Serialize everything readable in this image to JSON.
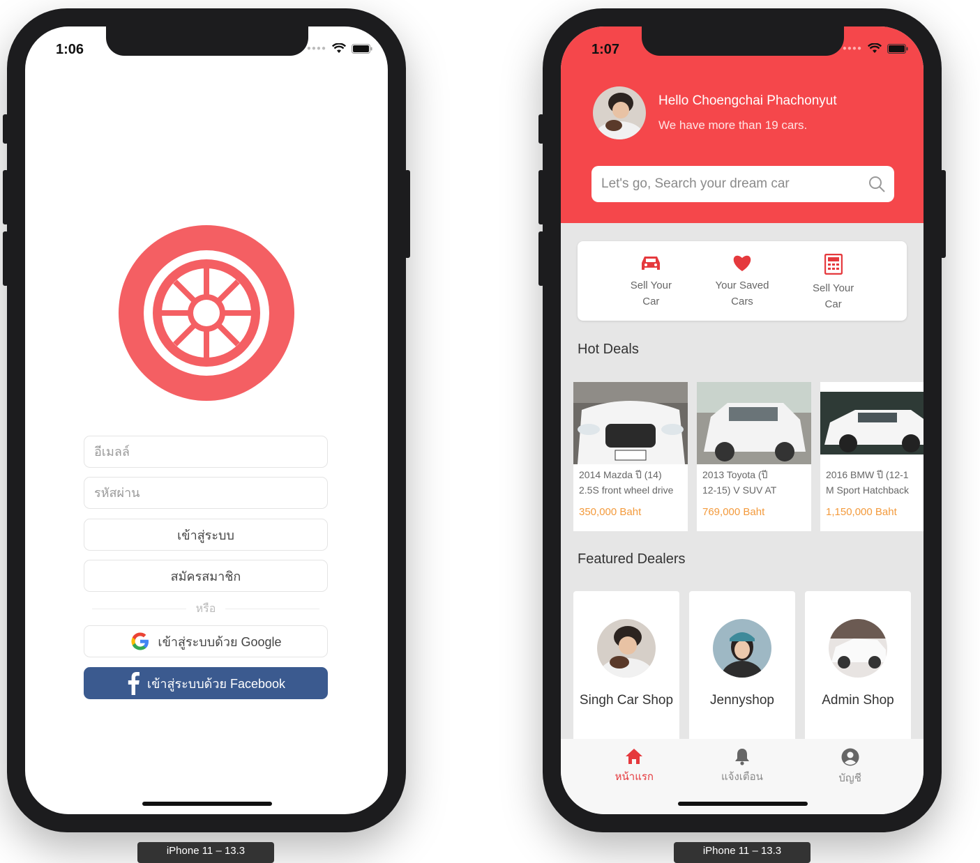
{
  "left_phone": {
    "status_time": "1:06",
    "login": {
      "email_placeholder": "อีเมลล์",
      "password_placeholder": "รหัสผ่าน",
      "login_label": "เข้าสู่ระบบ",
      "register_label": "สมัครสมาชิก",
      "or_label": "หรือ",
      "google_label": "เข้าสู่ระบบด้วย Google",
      "facebook_label": "เข้าสู่ระบบด้วย Facebook"
    },
    "device_label": "iPhone 11 – 13.3"
  },
  "right_phone": {
    "status_time": "1:07",
    "header": {
      "greeting": "Hello Choengchai Phachonyut",
      "subtitle": "We have more than 19 cars."
    },
    "search": {
      "placeholder": "Let's go, Search your dream car"
    },
    "quick_actions": [
      {
        "label": "Sell Your\nCar",
        "icon": "car-icon"
      },
      {
        "label": "Your Saved\nCars",
        "icon": "heart-icon"
      },
      {
        "label": "Sell Your\nCar",
        "icon": "calculator-icon"
      }
    ],
    "hot_deals_title": "Hot Deals",
    "hot_deals": [
      {
        "title": "2014 Mazda ปี (14)\n2.5S front wheel drive",
        "price": "350,000 Baht"
      },
      {
        "title": "2013 Toyota (ปี\n12-15) V SUV AT",
        "price": "769,000 Baht"
      },
      {
        "title": "2016 BMW ปี (12-1\nM Sport Hatchback",
        "price": "1,150,000 Baht"
      }
    ],
    "featured_dealers_title": "Featured Dealers",
    "dealers": [
      {
        "name": "Singh Car Shop"
      },
      {
        "name": "Jennyshop"
      },
      {
        "name": "Admin Shop"
      }
    ],
    "tabs": [
      {
        "label": "หน้าแรก",
        "icon": "home-icon"
      },
      {
        "label": "แจ้งเตือน",
        "icon": "bell-icon"
      },
      {
        "label": "บัญชี",
        "icon": "account-icon"
      }
    ],
    "device_label": "iPhone 11 – 13.3"
  },
  "colors": {
    "brand_red": "#f5474b",
    "logo_red": "#f45f63",
    "price_orange": "#f39a3c",
    "facebook_blue": "#3b5a8f"
  }
}
